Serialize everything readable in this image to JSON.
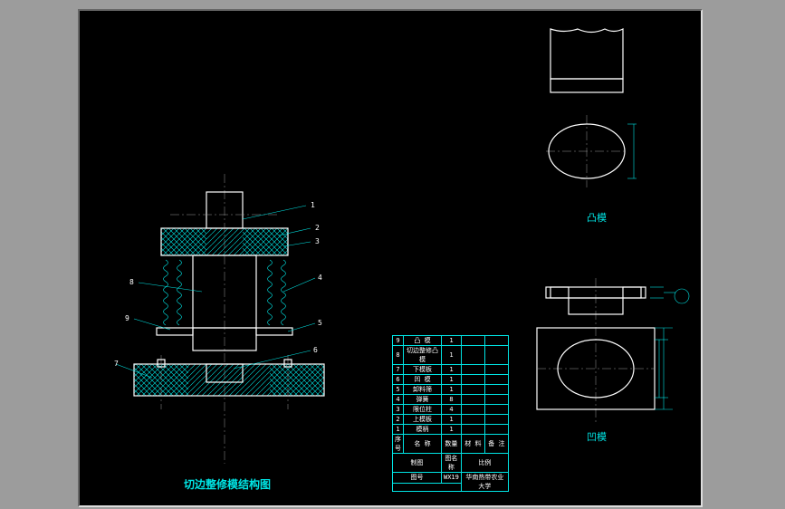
{
  "titles": {
    "main": "切边整修模结构图",
    "convex": "凸模",
    "concave": "凹模"
  },
  "leaders": {
    "l1": "1",
    "l2": "2",
    "l3": "3",
    "l4": "4",
    "l5": "5",
    "l6": "6",
    "l7": "7",
    "l8": "8",
    "l9": "9"
  },
  "table": {
    "rows": [
      {
        "num": "9",
        "name": "凸 模",
        "qty": "1",
        "mat": "",
        "note": ""
      },
      {
        "num": "8",
        "name": "切边整修凸模",
        "qty": "1",
        "mat": "",
        "note": ""
      },
      {
        "num": "7",
        "name": "下模板",
        "qty": "1",
        "mat": "",
        "note": ""
      },
      {
        "num": "6",
        "name": "凹 模",
        "qty": "1",
        "mat": "",
        "note": ""
      },
      {
        "num": "5",
        "name": "卸料筛",
        "qty": "1",
        "mat": "",
        "note": ""
      },
      {
        "num": "4",
        "name": "弹簧",
        "qty": "8",
        "mat": "",
        "note": ""
      },
      {
        "num": "3",
        "name": "限位柱",
        "qty": "4",
        "mat": "",
        "note": ""
      },
      {
        "num": "2",
        "name": "上模板",
        "qty": "1",
        "mat": "",
        "note": ""
      },
      {
        "num": "1",
        "name": "模柄",
        "qty": "1",
        "mat": "",
        "note": ""
      }
    ],
    "header": {
      "num": "序号",
      "name": "名 称",
      "qty": "数量",
      "mat": "材 料",
      "note": "备 注"
    },
    "titleblock": {
      "drawn": "制图",
      "check": "",
      "proj": "图名称",
      "scale": "比例",
      "proj_val": "",
      "scale_val": "",
      "no": "图号",
      "no_val": "WX19",
      "school": "华南热带农业大学"
    }
  }
}
